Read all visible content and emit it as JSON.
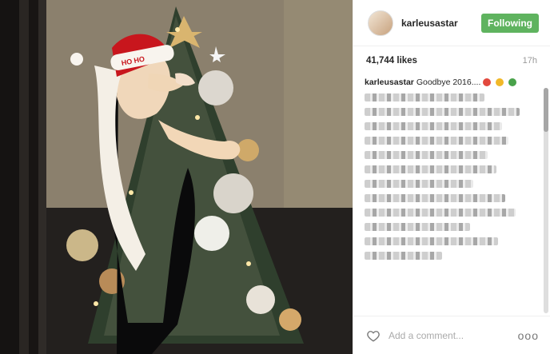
{
  "post": {
    "username": "karleusastar",
    "follow_label": "Following",
    "likes": "41,744 likes",
    "time": "17h",
    "caption_user": "karleusastar",
    "caption_text": "Goodbye 2016....",
    "add_comment_placeholder": "Add a comment...",
    "more_label": "ooo"
  },
  "photo": {
    "santa_hat_text": "HO HO"
  },
  "colors": {
    "following": "#5fb35f",
    "likes_text": "#262626",
    "muted_text": "#999999",
    "divider": "#efefef"
  },
  "icons": {
    "heart": "heart-icon",
    "more": "more-options-icon",
    "emoji_caption": [
      "santa-emoji",
      "face-emoji",
      "tree-emoji"
    ]
  }
}
